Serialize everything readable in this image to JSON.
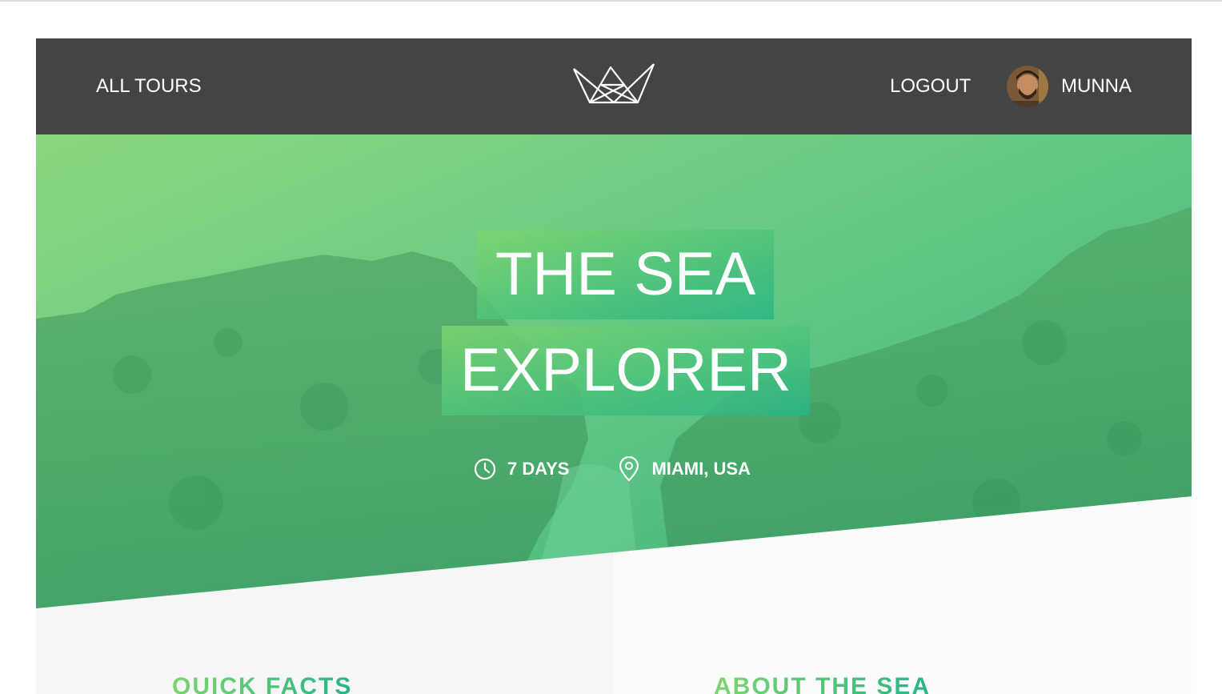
{
  "header": {
    "all_tours_label": "ALL TOURS",
    "logout_label": "LOGOUT",
    "user_name": "MUNNA",
    "logo_icon": "crown-logo-icon"
  },
  "hero": {
    "title_line_1": "THE SEA",
    "title_line_2": "EXPLORER",
    "duration": "7 DAYS",
    "location": "MIAMI, USA",
    "duration_icon": "clock-icon",
    "location_icon": "map-pin-icon",
    "gradient_start": "#7dd56f",
    "gradient_end": "#28b487"
  },
  "sections": {
    "quick_facts_heading": "QUICK FACTS",
    "about_heading": "ABOUT THE SEA"
  },
  "colors": {
    "header_bg": "#444444",
    "accent_green": "#55c57a"
  }
}
